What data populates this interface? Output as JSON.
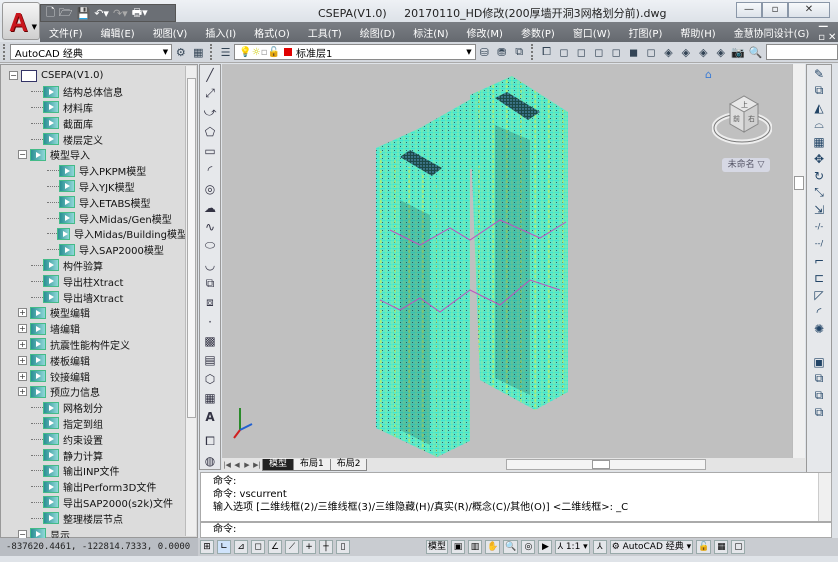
{
  "window": {
    "app_name": "CSEPA(V1.0)",
    "file_title": "20170110_HD修改(200厚墙开洞3网格划分前).dwg",
    "minimize": "—",
    "restore": "▫",
    "close": "✕"
  },
  "app_button": {
    "letter": "A"
  },
  "quick_access": {
    "icons": [
      "new-icon",
      "open-icon",
      "save-icon",
      "undo-icon",
      "redo-icon",
      "print-icon"
    ]
  },
  "menu": [
    "文件(F)",
    "编辑(E)",
    "视图(V)",
    "插入(I)",
    "格式(O)",
    "工具(T)",
    "绘图(D)",
    "标注(N)",
    "修改(M)",
    "参数(P)",
    "窗口(W)",
    "打图(P)",
    "帮助(H)",
    "金慧协同设计(G)"
  ],
  "mdi_controls": "—▫✕",
  "toolbar": {
    "workspace": "AutoCAD 经典",
    "layer": "标准层1",
    "layer_color": "#e00000"
  },
  "tree": [
    {
      "label": "CSEPA(V1.0)",
      "level": 0,
      "exp": "-",
      "root": true
    },
    {
      "label": "结构总体信息",
      "level": 1
    },
    {
      "label": "材料库",
      "level": 1
    },
    {
      "label": "截面库",
      "level": 1
    },
    {
      "label": "楼层定义",
      "level": 1
    },
    {
      "label": "模型导入",
      "level": 1,
      "exp": "-"
    },
    {
      "label": "导入PKPM模型",
      "level": 2
    },
    {
      "label": "导入YJK模型",
      "level": 2
    },
    {
      "label": "导入ETABS模型",
      "level": 2
    },
    {
      "label": "导入Midas/Gen模型",
      "level": 2
    },
    {
      "label": "导入Midas/Building模型",
      "level": 2
    },
    {
      "label": "导入SAP2000模型",
      "level": 2
    },
    {
      "label": "构件验算",
      "level": 1
    },
    {
      "label": "导出柱Xtract",
      "level": 1
    },
    {
      "label": "导出墙Xtract",
      "level": 1
    },
    {
      "label": "模型编辑",
      "level": 1,
      "exp": "+"
    },
    {
      "label": "墙编辑",
      "level": 1,
      "exp": "+"
    },
    {
      "label": "抗震性能构件定义",
      "level": 1,
      "exp": "+"
    },
    {
      "label": "楼板编辑",
      "level": 1,
      "exp": "+"
    },
    {
      "label": "铰接编辑",
      "level": 1,
      "exp": "+"
    },
    {
      "label": "预应力信息",
      "level": 1,
      "exp": "+"
    },
    {
      "label": "网格划分",
      "level": 1
    },
    {
      "label": "指定到组",
      "level": 1
    },
    {
      "label": "约束设置",
      "level": 1
    },
    {
      "label": "静力计算",
      "level": 1
    },
    {
      "label": "输出INP文件",
      "level": 1
    },
    {
      "label": "输出Perform3D文件",
      "level": 1
    },
    {
      "label": "导出SAP2000(s2k)文件",
      "level": 1
    },
    {
      "label": "整理楼层节点",
      "level": 1
    },
    {
      "label": "显示",
      "level": 1,
      "exp": "-"
    }
  ],
  "coords": "-837620.4461, -122814.7333, 0.0000",
  "viewport": {
    "view_name": "未命名 ▽",
    "cube_faces": {
      "top": "上",
      "front": "前",
      "right": "右"
    }
  },
  "layout_tabs": [
    "模型",
    "布局1",
    "布局2"
  ],
  "command": {
    "lines": [
      "命令:",
      "命令:  vscurrent",
      "输入选项 [二维线框(2)/三维线框(3)/三维隐藏(H)/真实(R)/概念(C)/其他(O)] <二维线框>: _C"
    ],
    "prompt": "命令:"
  },
  "status": {
    "model": "模型",
    "scale": "1:1 ▾",
    "workspace": "AutoCAD 经典 ▾"
  }
}
